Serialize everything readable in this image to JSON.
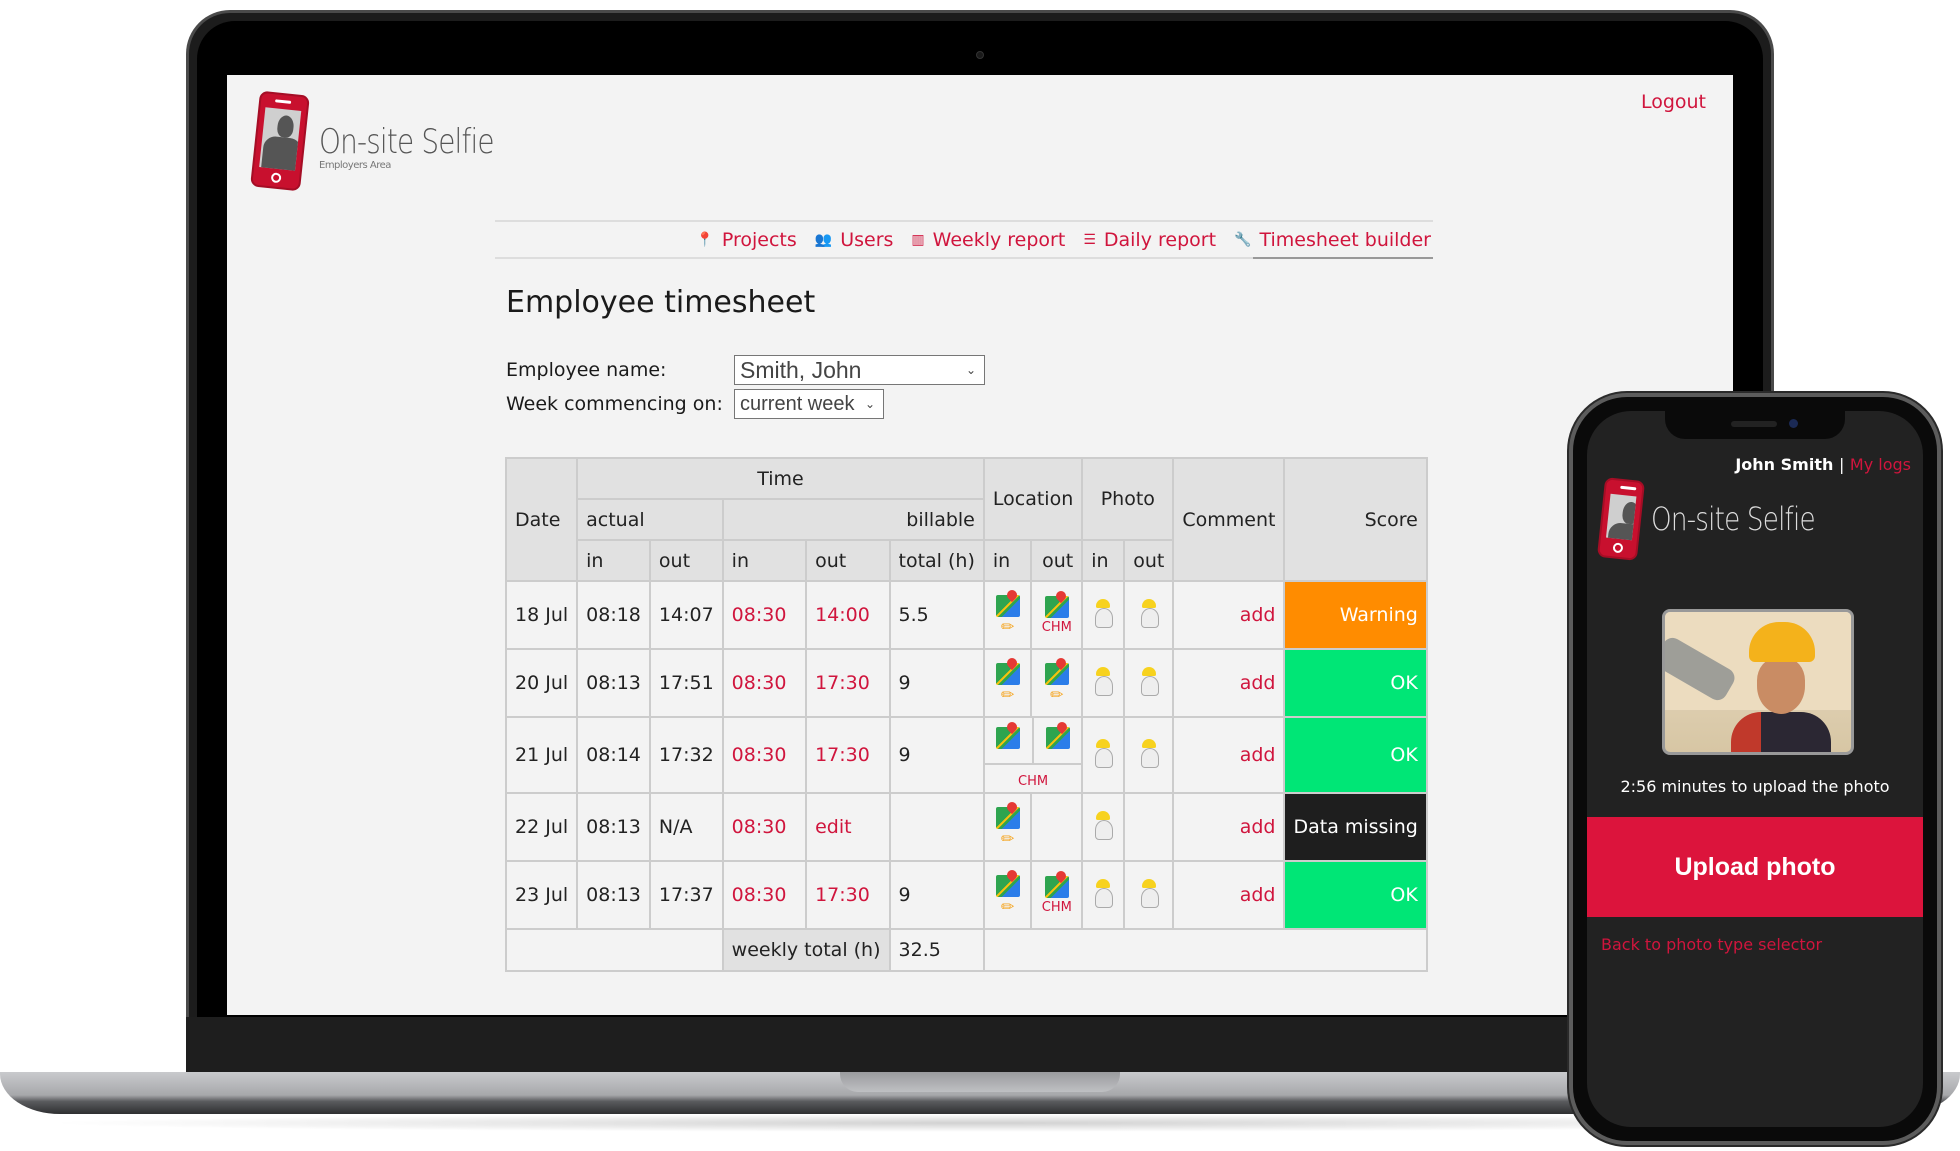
{
  "app": {
    "brand": "On-site Selfie",
    "brand_sub": "Employers Area",
    "logout": "Logout"
  },
  "nav": [
    {
      "icon": "map-marker-icon",
      "glyph": "📍",
      "label": "Projects"
    },
    {
      "icon": "users-icon",
      "glyph": "👥",
      "label": "Users"
    },
    {
      "icon": "columns-icon",
      "glyph": "▥",
      "label": "Weekly report"
    },
    {
      "icon": "list-icon",
      "glyph": "☰",
      "label": "Daily report"
    },
    {
      "icon": "wrench-icon",
      "glyph": "🔧",
      "label": "Timesheet builder",
      "active": true
    }
  ],
  "page": {
    "title": "Employee timesheet",
    "employee_label": "Employee name:",
    "employee_value": "Smith, John",
    "week_label": "Week commencing on:",
    "week_value": "current week"
  },
  "table": {
    "headers": {
      "date": "Date",
      "time": "Time",
      "actual": "actual",
      "billable": "billable",
      "location": "Location",
      "photo": "Photo",
      "comment": "Comment",
      "score": "Score",
      "in": "in",
      "out": "out",
      "total": "total (h)"
    },
    "rows": [
      {
        "date": "18 Jul",
        "actual_in": "08:18",
        "actual_out": "14:07",
        "bill_in": "08:30",
        "bill_out": "14:00",
        "total": "5.5",
        "loc_in_edit": true,
        "loc_out_tag": "CHM",
        "photo_in": true,
        "photo_out": true,
        "comment": "add",
        "score": "Warning",
        "score_type": "warn"
      },
      {
        "date": "20 Jul",
        "actual_in": "08:13",
        "actual_out": "17:51",
        "bill_in": "08:30",
        "bill_out": "17:30",
        "total": "9",
        "loc_in_edit": true,
        "loc_out_edit": true,
        "photo_in": true,
        "photo_out": true,
        "comment": "add",
        "score": "OK",
        "score_type": "ok"
      },
      {
        "date": "21 Jul",
        "actual_in": "08:14",
        "actual_out": "17:32",
        "bill_in": "08:30",
        "bill_out": "17:30",
        "total": "9",
        "loc_shared_tag": "CHM",
        "photo_in": true,
        "photo_out": true,
        "comment": "add",
        "score": "OK",
        "score_type": "ok"
      },
      {
        "date": "22 Jul",
        "actual_in": "08:13",
        "actual_out": "N/A",
        "bill_in": "08:30",
        "bill_out": "edit",
        "total": "",
        "loc_in_edit": true,
        "loc_out_missing": true,
        "photo_in": true,
        "photo_out": false,
        "comment": "add",
        "score": "Data missing",
        "score_type": "miss"
      },
      {
        "date": "23 Jul",
        "actual_in": "08:13",
        "actual_out": "17:37",
        "bill_in": "08:30",
        "bill_out": "17:30",
        "total": "9",
        "loc_in_edit": true,
        "loc_out_tag": "CHM",
        "photo_in": true,
        "photo_out": true,
        "comment": "add",
        "score": "OK",
        "score_type": "ok"
      }
    ],
    "footer_label": "weekly total (h)",
    "footer_value": "32.5"
  },
  "colors": {
    "accent": "#d0153d",
    "warning": "#ff8c00",
    "ok": "#00e676",
    "missing": "#1e1e1e",
    "upload_button": "#dc143c"
  },
  "mobile": {
    "user": "John Smith",
    "separator": "|",
    "my_logs": "My logs",
    "brand": "On-site Selfie",
    "timer": "2:56 minutes  to upload the photo",
    "upload": "Upload photo",
    "back": "Back to photo type selector"
  }
}
